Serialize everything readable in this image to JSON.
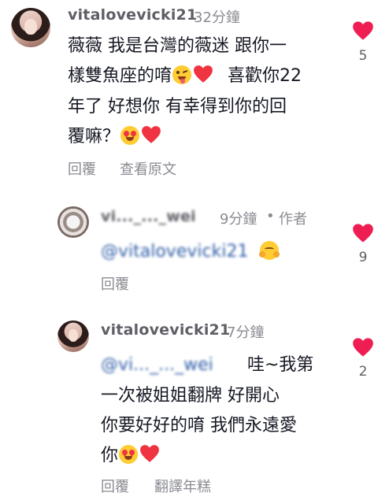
{
  "comments": [
    {
      "username": "vitalovevicki21",
      "time": "32分鐘",
      "lines": [
        "薇薇 我是台灣的薇迷 跟你一",
        "樣雙魚座的唷",
        "喜歡你22",
        "年了 好想你 有幸得到你的回",
        "覆嘛？"
      ],
      "reply_label": "回覆",
      "translate_label": "查看原文",
      "like_count": "5"
    },
    {
      "username": "vi..._..._wei",
      "time": "9分鐘",
      "author_tag": "作者",
      "mention": "@vitalovevicki21",
      "reply_label": "回覆",
      "like_count": "9"
    },
    {
      "username": "vitalovevicki21",
      "time": "7分鐘",
      "mention": "@vi..._..._wei",
      "lines": [
        "哇~我第",
        "一次被姐姐翻牌 好開心",
        "你要好好的唷 我們永遠愛",
        "你"
      ],
      "reply_label": "回覆",
      "translate_label": "翻譯年糕",
      "like_count": "2"
    }
  ],
  "icons": {
    "like": "heart-icon",
    "heart_eyes": "smiling-face-heart-eyes-emoji",
    "tongue": "winking-face-tongue-emoji",
    "hug": "hugging-face-emoji",
    "red_heart": "red-heart-emoji"
  },
  "colors": {
    "like_red": "#ee1d52",
    "mention_blue": "#2f5da8",
    "meta_gray": "#8a8b91"
  }
}
